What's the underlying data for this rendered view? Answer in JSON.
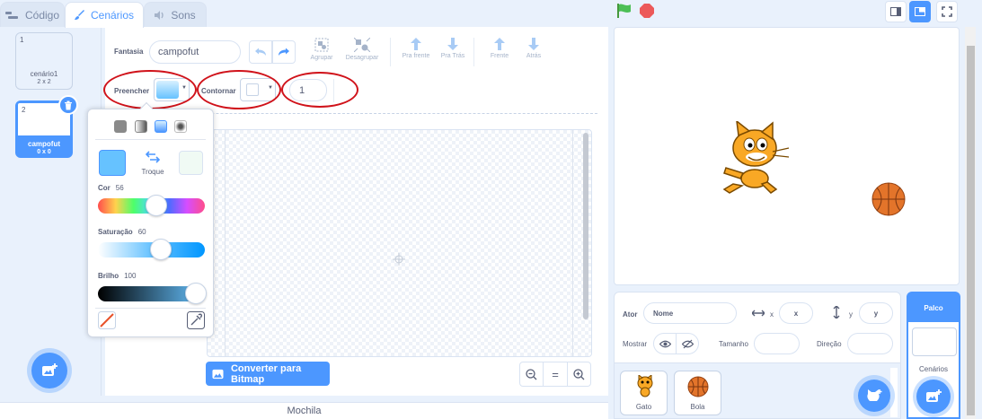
{
  "tabs": [
    {
      "label": "Código",
      "icon": "code-blocks-icon"
    },
    {
      "label": "Cenários",
      "icon": "paintbrush-icon"
    },
    {
      "label": "Sons",
      "icon": "speaker-icon"
    }
  ],
  "costumes": [
    {
      "number": "1",
      "name": "cenário1",
      "size": "2 x 2"
    },
    {
      "number": "2",
      "name": "campofut",
      "size": "0 x 0",
      "selected": true
    }
  ],
  "toolbar": {
    "fantasia_label": "Fantasia",
    "costume_name": "campofut",
    "group_label": "Agrupar",
    "ungroup_label": "Desagrupar",
    "forward_label": "Pra frente",
    "backward_label": "Pra Trás",
    "front_label": "Frente",
    "back_label": "Atrás",
    "fill_label": "Preencher",
    "stroke_label": "Contornar",
    "stroke_width": "1"
  },
  "color_picker": {
    "swap_label": "Troque",
    "color_label": "Cor",
    "color_value": "56",
    "saturation_label": "Saturação",
    "saturation_value": "60",
    "brightness_label": "Brilho",
    "brightness_value": "100",
    "fill_color": "#66c2ff"
  },
  "canvas": {
    "convert_label": "Converter para Bitmap"
  },
  "zoom": {
    "out": "−",
    "reset": "=",
    "in": "+"
  },
  "sprite_info": {
    "sprite_label": "Ator",
    "name_placeholder": "Nome",
    "x_label": "x",
    "x_placeholder": "x",
    "y_label": "y",
    "y_placeholder": "y",
    "show_label": "Mostrar",
    "size_label": "Tamanho",
    "direction_label": "Direção"
  },
  "sprites": [
    {
      "name": "Gato"
    },
    {
      "name": "Bola"
    }
  ],
  "stage_panel": {
    "header": "Palco",
    "backdrops_label": "Cenários"
  },
  "backpack_label": "Mochila"
}
